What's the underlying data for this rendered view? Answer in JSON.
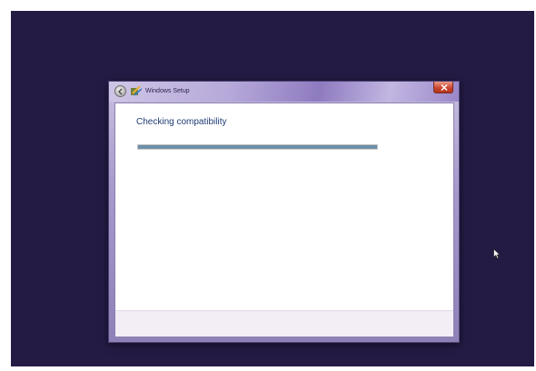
{
  "window": {
    "title": "Windows Setup"
  },
  "main": {
    "heading": "Checking compatibility",
    "progress_fraction": 1.0
  },
  "icons": {
    "back": "back-arrow-icon",
    "app": "windows-setup-icon",
    "close": "close-icon",
    "cursor": "mouse-pointer-icon"
  },
  "colors": {
    "desktop_background": "#231b44",
    "progress_fill": "#6b8fa8",
    "close_button": "#c9442c",
    "heading_text": "#1f3b74"
  }
}
